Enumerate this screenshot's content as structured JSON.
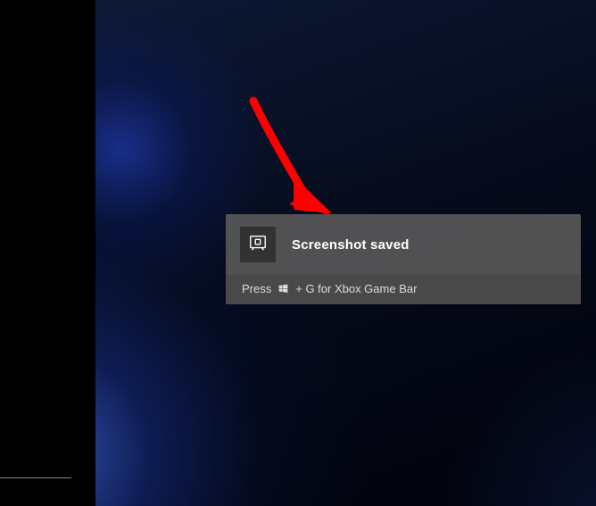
{
  "notification": {
    "title": "Screenshot saved",
    "hint_prefix": "Press",
    "hint_suffix": "+ G for Xbox Game Bar",
    "icon_name": "screenshot-icon",
    "winkey_name": "windows-key-icon"
  }
}
